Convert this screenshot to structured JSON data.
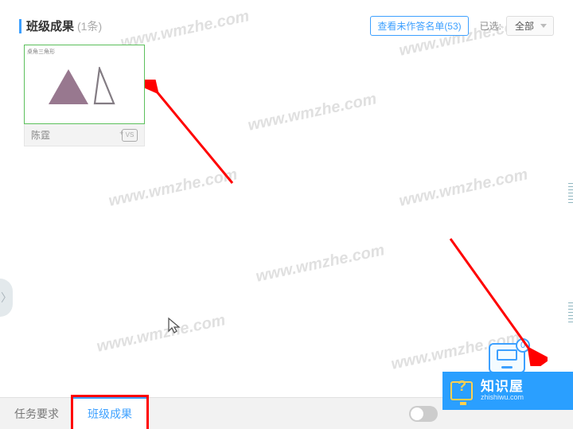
{
  "header": {
    "title": "班级成果",
    "count_label": "(1条)",
    "unanswered_link": "查看未作答名单(53)",
    "selected_label": "已选:",
    "dropdown_value": "全部"
  },
  "card": {
    "thumb_label": "桌角三角形",
    "student_name": "陈霆",
    "vs_label": "VS"
  },
  "dock": {
    "badge_count": "0"
  },
  "bottom_tabs": {
    "task": "任务要求",
    "results": "班级成果"
  },
  "brand": {
    "cn": "知识屋",
    "en": "zhishiwu.com"
  },
  "watermark": "www.wmzhe.com",
  "side_handle": "〉"
}
